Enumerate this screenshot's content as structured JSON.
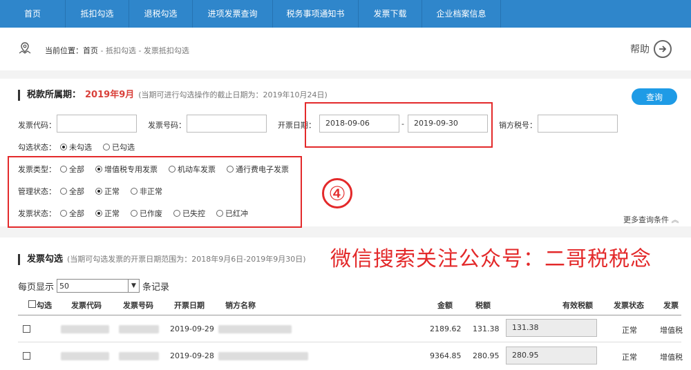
{
  "nav": [
    "首页",
    "抵扣勾选",
    "退税勾选",
    "进项发票查询",
    "税务事项通知书",
    "发票下载",
    "企业档案信息"
  ],
  "breadcrumb": {
    "prefix": "当前位置：",
    "home": "首页",
    "path": " - 抵扣勾选 - 发票抵扣勾选"
  },
  "help": {
    "label": "帮助"
  },
  "tax_period": {
    "title": "税款所属期：",
    "value": "2019年9月",
    "note": "(当期可进行勾选操作的截止日期为：2019年10月24日)"
  },
  "query_button": "查询",
  "filters": {
    "invoice_code_label": "发票代码：",
    "invoice_number_label": "发票号码：",
    "issue_date_label": "开票日期：",
    "date_from": "2018-09-06",
    "date_sep": "-",
    "date_to": "2019-09-30",
    "seller_tax_label": "销方税号：",
    "check_status": {
      "label": "勾选状态：",
      "options": [
        "未勾选",
        "已勾选"
      ]
    },
    "invoice_type": {
      "label": "发票类型：",
      "options": [
        "全部",
        "增值税专用发票",
        "机动车发票",
        "通行费电子发票"
      ]
    },
    "manage_status": {
      "label": "管理状态：",
      "options": [
        "全部",
        "正常",
        "非正常"
      ]
    },
    "invoice_status": {
      "label": "发票状态：",
      "options": [
        "全部",
        "正常",
        "已作废",
        "已失控",
        "已红冲"
      ]
    },
    "more": "更多查询条件"
  },
  "annotation": {
    "number": "④",
    "wechat": "微信搜索关注公众号：二哥税税念"
  },
  "selection": {
    "title": "发票勾选",
    "note": "(当期可勾选发票的开票日期范围为：2018年9月6日-2019年9月30日)",
    "page_size_prefix": "每页显示",
    "page_size": "50",
    "page_size_suffix": "条记录"
  },
  "table": {
    "headers": {
      "check": "勾选",
      "code": "发票代码",
      "number": "发票号码",
      "date": "开票日期",
      "seller": "销方名称",
      "amount": "金额",
      "tax": "税额",
      "effective": "有效税额",
      "status": "发票状态",
      "type": "发票"
    },
    "rows": [
      {
        "date": "2019-09-29",
        "amount": "2189.62",
        "tax": "131.38",
        "effective": "131.38",
        "status": "正常",
        "type": "增值税"
      },
      {
        "date": "2019-09-28",
        "amount": "9364.85",
        "tax": "280.95",
        "effective": "280.95",
        "status": "正常",
        "type": "增值税"
      }
    ]
  }
}
